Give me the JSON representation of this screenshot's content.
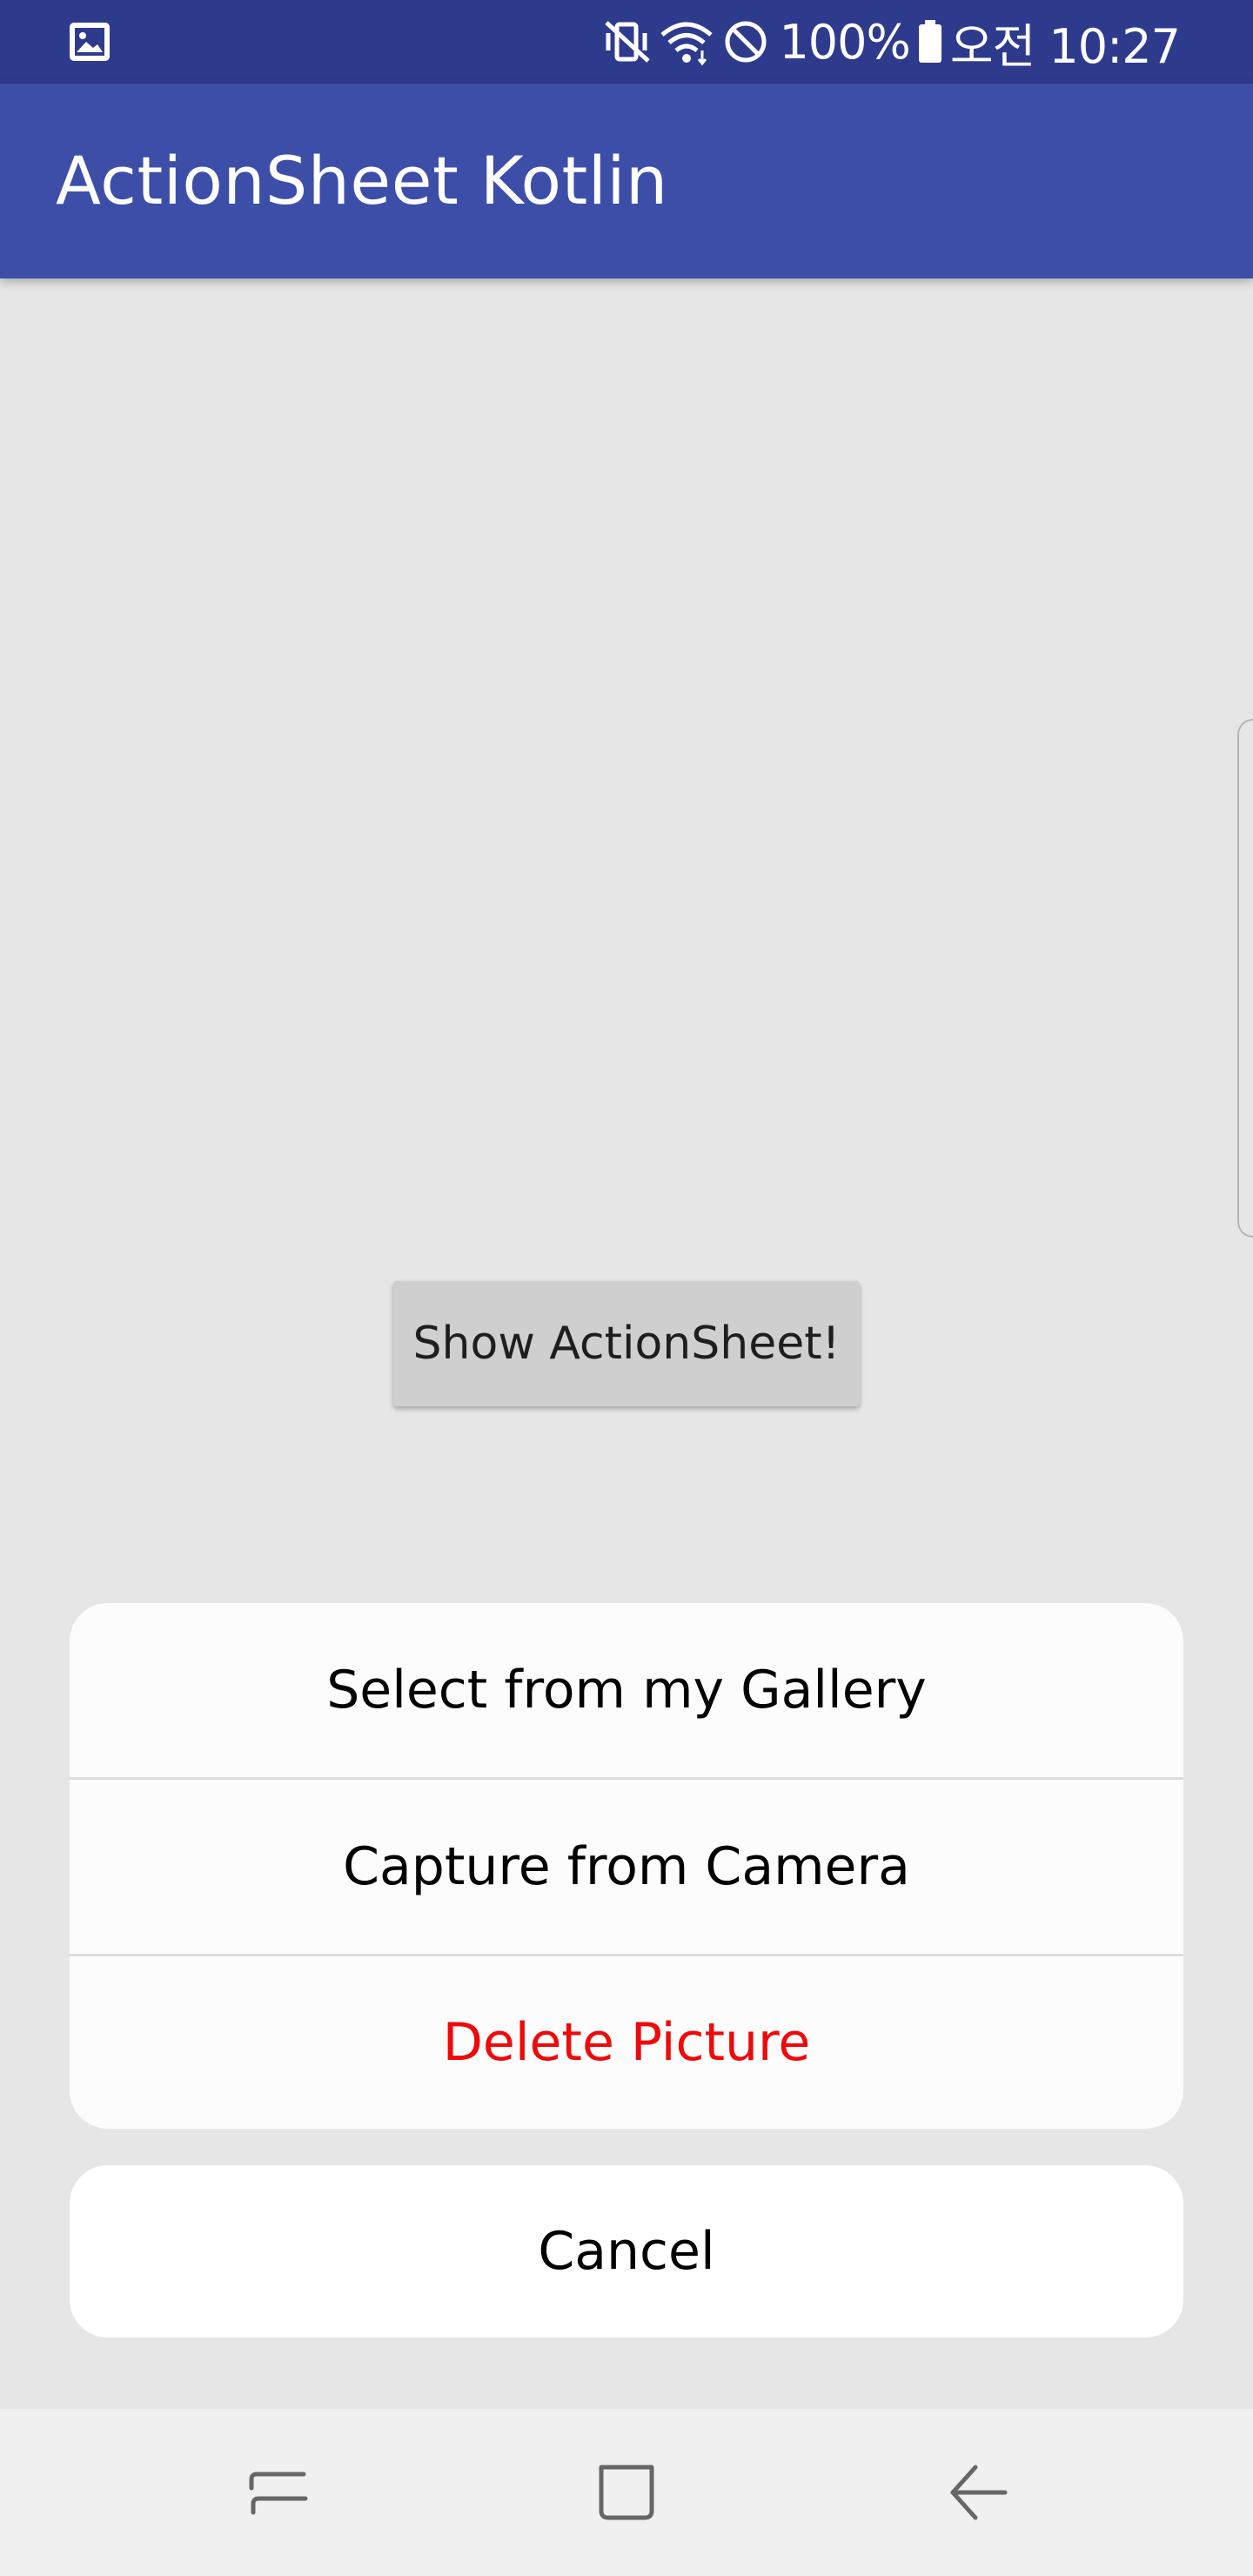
{
  "status_bar": {
    "left_icon": "image-notification-icon",
    "icons": [
      "vibrate-mute-icon",
      "wifi-icon",
      "do-not-disturb-icon"
    ],
    "battery_percent": "100%",
    "battery_icon": "battery-full-icon",
    "time": "오전 10:27"
  },
  "app_bar": {
    "title": "ActionSheet Kotlin",
    "color": "#3d4ea9"
  },
  "main": {
    "show_button_label": "Show ActionSheet!"
  },
  "action_sheet": {
    "items": [
      {
        "label": "Select from my Gallery"
      },
      {
        "label": "Capture from Camera"
      },
      {
        "label": "Delete Picture",
        "destructive": true,
        "color": "#ee0a0a"
      }
    ],
    "cancel_label": "Cancel"
  },
  "nav_bar": {
    "buttons": [
      "recent-apps-icon",
      "home-icon",
      "back-icon"
    ]
  }
}
